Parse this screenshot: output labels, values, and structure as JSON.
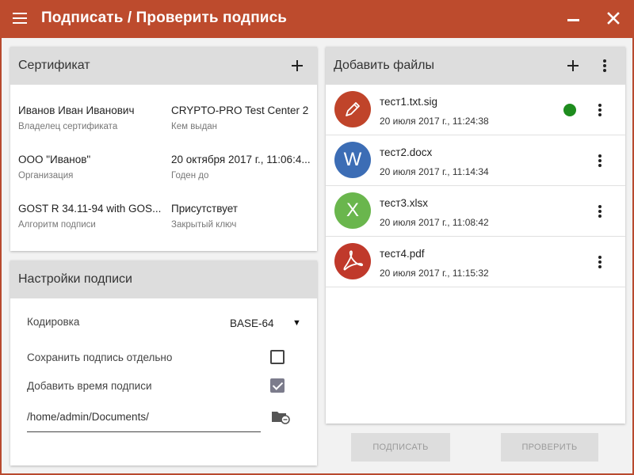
{
  "window": {
    "title": "Подписать / Проверить подпись",
    "accent_color": "#bd4b2d"
  },
  "certificate": {
    "header": "Сертификат",
    "fields": [
      {
        "value": "Иванов Иван Иванович",
        "label": "Владелец сертификата"
      },
      {
        "value": "CRYPTO-PRO Test Center 2",
        "label": "Кем выдан"
      },
      {
        "value": "ООО \"Иванов\"",
        "label": "Организация"
      },
      {
        "value": "20 октября 2017 г., 11:06:4...",
        "label": "Годен до"
      },
      {
        "value": "GOST R 34.11-94 with GOS...",
        "label": "Алгоритм подписи"
      },
      {
        "value": "Присутствует",
        "label": "Закрытый ключ"
      }
    ]
  },
  "settings": {
    "header": "Настройки подписи",
    "encoding_label": "Кодировка",
    "encoding_value": "BASE-64",
    "save_separately_label": "Сохранить подпись отдельно",
    "save_separately_checked": false,
    "add_time_label": "Добавить время подписи",
    "add_time_checked": true,
    "path_value": "/home/admin/Documents/"
  },
  "files": {
    "header": "Добавить файлы",
    "items": [
      {
        "name": "тест1.txt.sig",
        "date": "20 июля 2017 г., 11:24:38",
        "icon": "pencil-icon",
        "icon_color": "#c0442a",
        "status": "green",
        "status_color": "#1e8c1e"
      },
      {
        "name": "тест2.docx",
        "date": "20 июля 2017 г., 11:14:34",
        "icon": "W",
        "icon_color": "#3c6db5"
      },
      {
        "name": "тест3.xlsx",
        "date": "20 июля 2017 г., 11:08:42",
        "icon": "X",
        "icon_color": "#6ab64d"
      },
      {
        "name": "тест4.pdf",
        "date": "20 июля 2017 г., 11:15:32",
        "icon": "acrobat-icon",
        "icon_color": "#c0392b"
      }
    ]
  },
  "actions": {
    "sign_label": "ПОДПИСАТЬ",
    "verify_label": "ПРОВЕРИТЬ"
  }
}
